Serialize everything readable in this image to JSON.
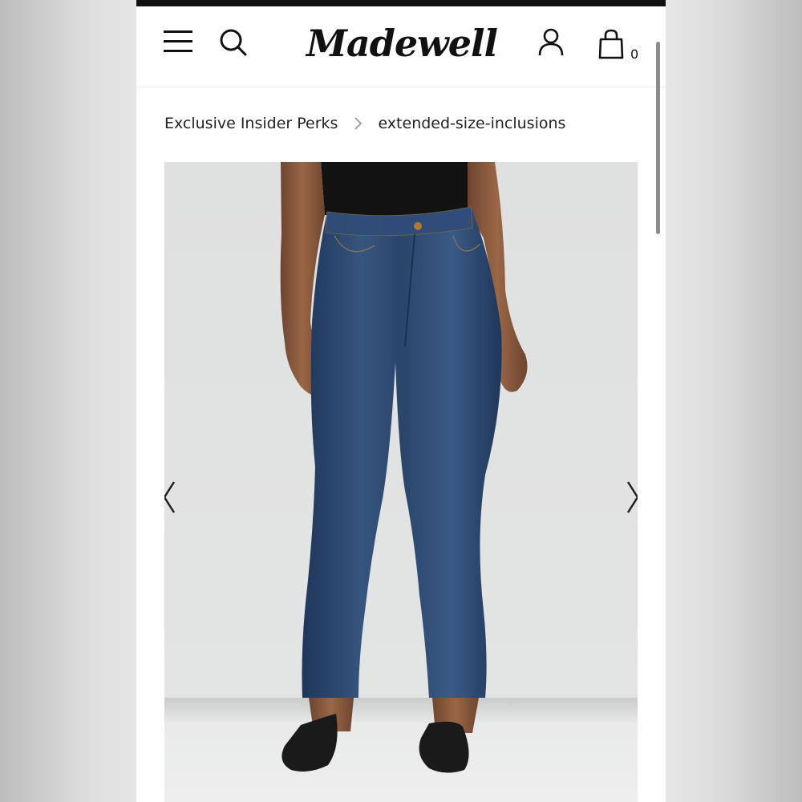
{
  "app": {
    "brand": "Madewell",
    "bag_count": "0"
  },
  "header": {
    "menu_icon": "hamburger-menu-icon",
    "search_icon": "search-icon",
    "account_icon": "user-account-icon",
    "bag_icon": "shopping-bag-icon"
  },
  "breadcrumb": {
    "items": [
      {
        "label": "Exclusive Insider Perks"
      },
      {
        "label": "extended-size-inclusions"
      }
    ],
    "separator_icon": "chevron-right-icon"
  },
  "carousel": {
    "prev_icon": "chevron-left-icon",
    "next_icon": "chevron-right-icon"
  },
  "colors": {
    "denim": "#2c4a73",
    "top": "#121212",
    "skin": "#8a5a3c",
    "backdrop": "#dfe0e0",
    "text": "#111111"
  }
}
